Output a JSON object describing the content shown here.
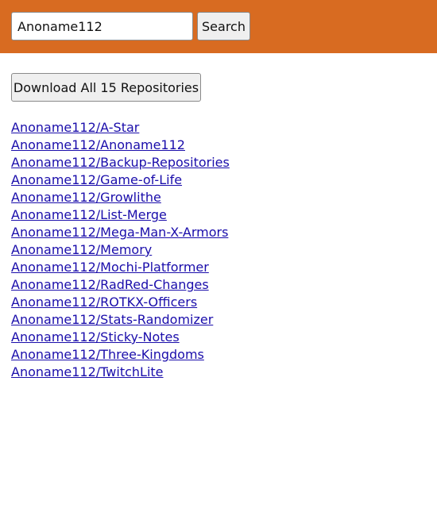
{
  "search": {
    "value": "Anoname112",
    "button_label": "Search"
  },
  "download": {
    "label": "Download All 15 Repositories"
  },
  "repositories": [
    "Anoname112/A-Star",
    "Anoname112/Anoname112",
    "Anoname112/Backup-Repositories",
    "Anoname112/Game-of-Life",
    "Anoname112/Growlithe",
    "Anoname112/List-Merge",
    "Anoname112/Mega-Man-X-Armors",
    "Anoname112/Memory",
    "Anoname112/Mochi-Platformer",
    "Anoname112/RadRed-Changes",
    "Anoname112/ROTKX-Officers",
    "Anoname112/Stats-Randomizer",
    "Anoname112/Sticky-Notes",
    "Anoname112/Three-Kingdoms",
    "Anoname112/TwitchLite"
  ],
  "colors": {
    "header_background": "#d86b21",
    "link": "#1a0dab"
  }
}
